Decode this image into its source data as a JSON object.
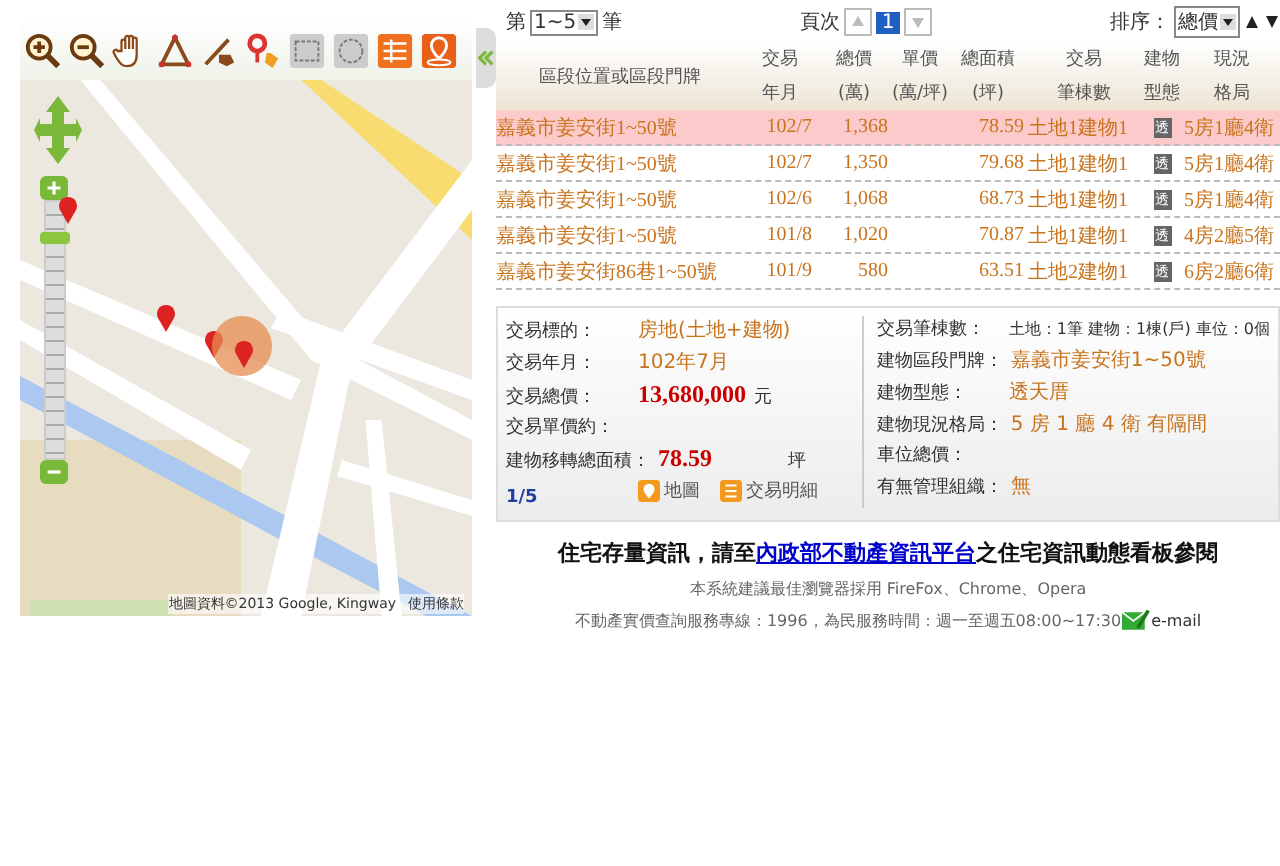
{
  "map": {
    "zoom": {
      "level": 0.88
    },
    "attribution": "地圖資料©2013 Google, Kingway",
    "terms": "使用條款"
  },
  "pager": {
    "prefix": "第",
    "range": "1~5",
    "suffix": "筆",
    "page_label": "頁次",
    "page": "1",
    "sort_label": "排序：",
    "sort": "總價"
  },
  "table": {
    "columns": [
      [
        "區段位置或區段門牌"
      ],
      [
        "交易",
        "年月"
      ],
      [
        "總價",
        "(萬)"
      ],
      [
        "單價",
        "(萬/坪)"
      ],
      [
        "總面積",
        "(坪)"
      ],
      [
        "交易",
        "筆棟數"
      ],
      [
        "建物",
        "型態"
      ],
      [
        "現況",
        "格局"
      ]
    ],
    "rows": [
      {
        "address": "嘉義市姜安街1~50號",
        "date": "102/7",
        "price": "1,368",
        "area": "78.59",
        "count": "土地1建物1",
        "type": "透",
        "layout": "5房1廳4衛",
        "selected": true
      },
      {
        "address": "嘉義市姜安街1~50號",
        "date": "102/7",
        "price": "1,350",
        "area": "79.68",
        "count": "土地1建物1",
        "type": "透",
        "layout": "5房1廳4衛",
        "selected": false
      },
      {
        "address": "嘉義市姜安街1~50號",
        "date": "102/6",
        "price": "1,068",
        "area": "68.73",
        "count": "土地1建物1",
        "type": "透",
        "layout": "5房1廳4衛",
        "selected": false
      },
      {
        "address": "嘉義市姜安街1~50號",
        "date": "101/8",
        "price": "1,020",
        "area": "70.87",
        "count": "土地1建物1",
        "type": "透",
        "layout": "4房2廳5衛",
        "selected": false
      },
      {
        "address": "嘉義市姜安街86巷1~50號",
        "date": "101/9",
        "price": "580",
        "area": "63.51",
        "count": "土地2建物1",
        "type": "透",
        "layout": "6房2廳6衛",
        "selected": false
      }
    ]
  },
  "detail": {
    "left": [
      {
        "label": "交易標的：",
        "value": "房地(土地+建物)",
        "kind": "plain"
      },
      {
        "label": "交易年月：",
        "value": "102年7月",
        "kind": "plain"
      },
      {
        "label": "交易總價：",
        "value": "13,680,000",
        "unit": "元",
        "kind": "big"
      },
      {
        "label": "交易單價約："
      },
      {
        "label": "建物移轉總面積：",
        "value": "78.59",
        "unit": "坪",
        "kind": "big"
      }
    ],
    "index": "1/5",
    "map_link": "地圖",
    "detail_link": "交易明細",
    "right": [
      {
        "label": "交易筆棟數：",
        "value": "土地：1筆 建物：1棟(戶) 車位：0個",
        "kind": "dark"
      },
      {
        "label": "建物區段門牌：",
        "value": "嘉義市姜安街1~50號",
        "kind": "plain"
      },
      {
        "label": "建物型態：",
        "value": "透天厝",
        "kind": "plain"
      },
      {
        "label": "建物現況格局：",
        "value": "5 房 1 廳 4 衛 有隔間",
        "kind": "plain"
      },
      {
        "label": "車位總價："
      },
      {
        "label": "有無管理組織：",
        "value": "無",
        "kind": "plain"
      }
    ]
  },
  "notice": {
    "before": "住宅存量資訊，請至",
    "link": "內政部不動產資訊平台",
    "after": "之住宅資訊動態看板參閱"
  },
  "footer": {
    "browsers": "本系統建議最佳瀏覽器採用 FireFox、Chrome、Opera",
    "hotline": "不動產實價查詢服務專線：1996，為民服務時間：週一至週五08:00~17:30",
    "email": "e-mail"
  }
}
